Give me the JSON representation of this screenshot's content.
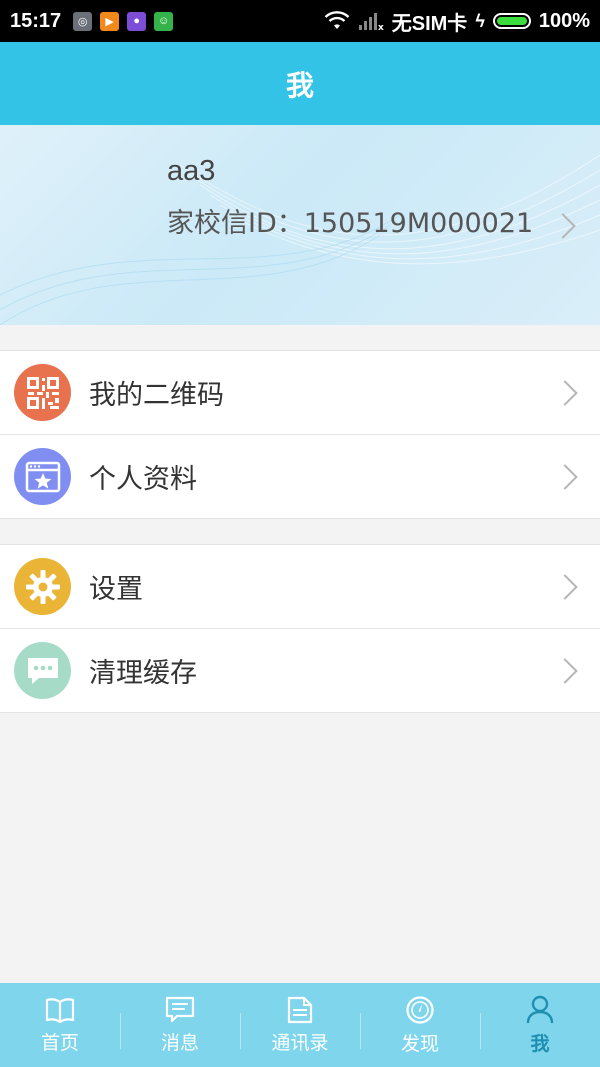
{
  "status_bar": {
    "time": "15:17",
    "carrier": "无SIM卡",
    "battery": "100%",
    "battery_level": 1.0
  },
  "header": {
    "title": "我"
  },
  "profile": {
    "name": "aa3",
    "id_line": "家校信ID：150519M000021"
  },
  "groups": [
    {
      "items": [
        {
          "label": "我的二维码",
          "icon": "qr-code-icon",
          "color": "#e8714e"
        },
        {
          "label": "个人资料",
          "icon": "profile-card-icon",
          "color": "#7f8ef0"
        }
      ]
    },
    {
      "items": [
        {
          "label": "设置",
          "icon": "gear-icon",
          "color": "#eab536"
        },
        {
          "label": "清理缓存",
          "icon": "chat-bubble-icon",
          "color": "#a6dcc7"
        }
      ]
    }
  ],
  "nav": {
    "items": [
      {
        "label": "首页",
        "icon": "book-icon"
      },
      {
        "label": "消息",
        "icon": "message-icon"
      },
      {
        "label": "通讯录",
        "icon": "contacts-icon"
      },
      {
        "label": "发现",
        "icon": "compass-icon"
      },
      {
        "label": "我",
        "icon": "person-icon"
      }
    ],
    "active": "我"
  },
  "colors": {
    "header": "#33c3e6",
    "nav_bg": "#7fd6ec",
    "nav_active": "#1f8fb1"
  }
}
